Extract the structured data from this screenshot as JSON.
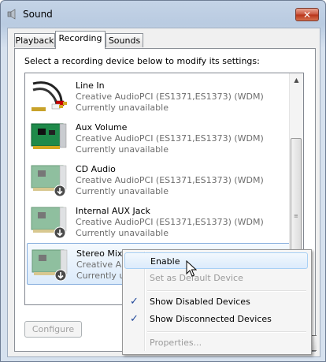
{
  "window": {
    "title": "Sound",
    "close_label": "✕"
  },
  "tabs": [
    {
      "label": "Playback",
      "active": false
    },
    {
      "label": "Recording",
      "active": true
    },
    {
      "label": "Sounds",
      "active": false
    }
  ],
  "instruction": "Select a recording device below to modify its settings:",
  "devices": [
    {
      "name": "Line In",
      "driver": "Creative AudioPCI (ES1371,ES1373) (WDM)",
      "status": "Currently unavailable",
      "icon": "rca-cable-icon",
      "disabled": false
    },
    {
      "name": "Aux Volume",
      "driver": "Creative AudioPCI (ES1371,ES1373) (WDM)",
      "status": "Currently unavailable",
      "icon": "sound-card-icon",
      "disabled": false
    },
    {
      "name": "CD Audio",
      "driver": "Creative AudioPCI (ES1371,ES1373) (WDM)",
      "status": "Currently unavailable",
      "icon": "sound-card-disabled-icon",
      "disabled": true
    },
    {
      "name": "Internal AUX Jack",
      "driver": "Creative AudioPCI (ES1371,ES1373) (WDM)",
      "status": "Currently unavailable",
      "icon": "sound-card-disabled-icon",
      "disabled": true
    },
    {
      "name": "Stereo Mix",
      "driver": "Creative Au",
      "status": "Currently una",
      "icon": "sound-card-disabled-icon",
      "disabled": true,
      "selected": true
    }
  ],
  "buttons": {
    "configure": "Configure"
  },
  "context_menu": {
    "enable": "Enable",
    "set_default": "Set as Default Device",
    "show_disabled": "Show Disabled Devices",
    "show_disconnected": "Show Disconnected Devices",
    "properties": "Properties...",
    "check_glyph": "✓"
  },
  "colors": {
    "accent": "#21489a",
    "selection_border": "#84acdd",
    "close_red": "#c9533b"
  }
}
